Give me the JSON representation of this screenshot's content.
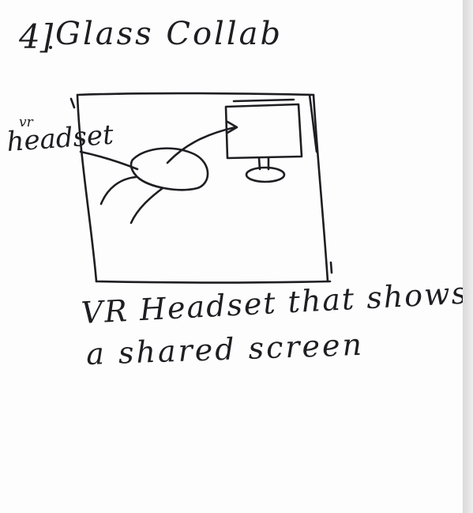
{
  "sketch": {
    "page_number": "4]",
    "title": "Glass Collab",
    "labels": {
      "vr": "vr",
      "headset": "headset"
    },
    "caption": {
      "line1": "VR Headset that shows",
      "line2": "a shared screen"
    },
    "ink_color": "#1e1e22",
    "paper_color": "#fdfdfd"
  }
}
